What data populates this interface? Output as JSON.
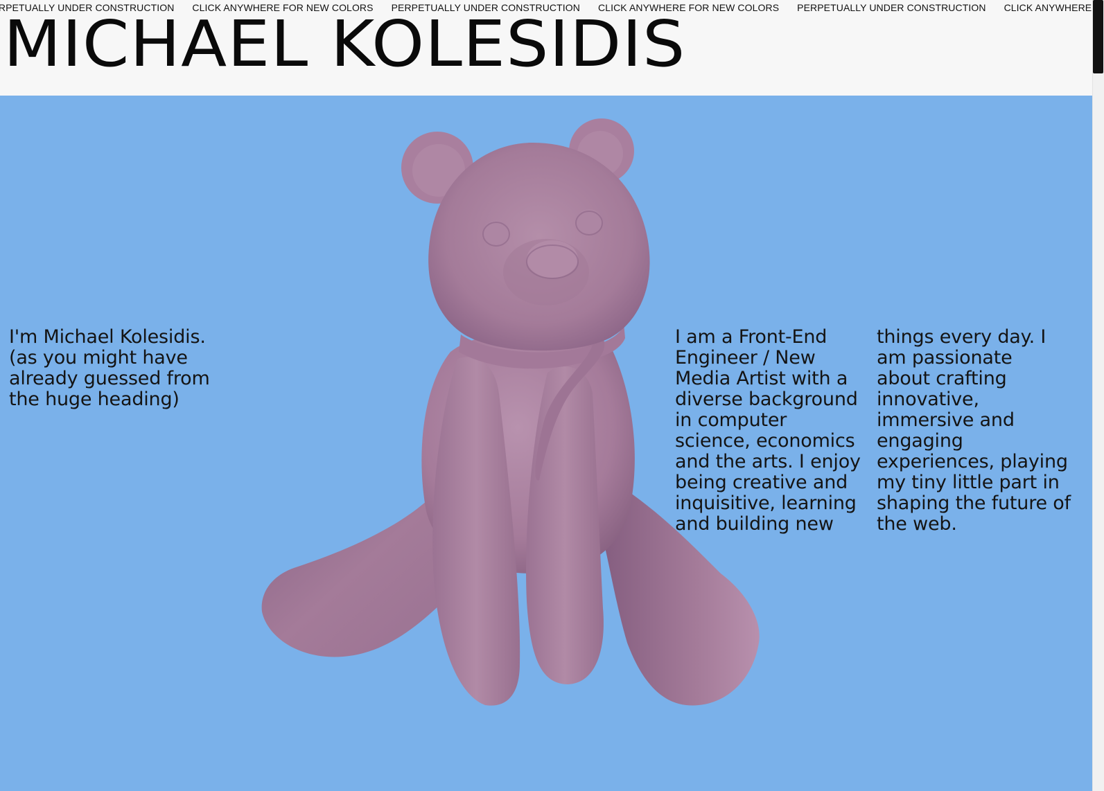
{
  "marquee": {
    "items": [
      "PERPETUALLY UNDER CONSTRUCTION",
      "CLICK ANYWHERE FOR NEW COLORS",
      "PERPETUALLY UNDER CONSTRUCTION",
      "CLICK ANYWHERE FOR NEW COLORS",
      "PERPETUALLY UNDER CONSTRUCTION",
      "CLICK ANYWHERE FOR NEW COLORS"
    ]
  },
  "header": {
    "title": "MICHAEL KOLESIDIS"
  },
  "hero": {
    "intro": "I'm Michael Kolesidis. (as you might have already guessed from the huge heading)",
    "bio_part1": "I am a Front-End Engineer / New Media Artist with a diverse background in computer science, economics and the arts. I enjoy being creative and inquisitive, learning and building new",
    "bio_part2": "things every day. I am passionate about crafting innovative, immersive and engaging experiences, playing my tiny little part in shaping the future of the web."
  },
  "colors": {
    "background": "#f7f7f7",
    "hero_background": "#7ab1ea",
    "bear": "#a9809f",
    "text": "#141414"
  },
  "icons": {
    "bear": "teddy-bear-3d-model"
  }
}
